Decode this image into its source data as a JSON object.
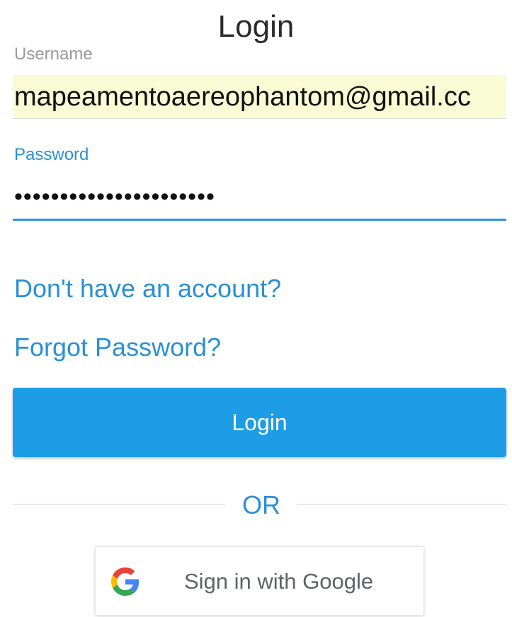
{
  "page": {
    "title": "Login"
  },
  "form": {
    "username_label": "Username",
    "username_value": "mapeamentoaereophantom@gmail.cc",
    "password_label": "Password",
    "password_value": "••••••••••••••••••••••"
  },
  "links": {
    "signup": "Don't have an account?",
    "forgot": "Forgot Password?"
  },
  "buttons": {
    "login": "Login",
    "google": "Sign in with Google"
  },
  "divider": {
    "text": "OR"
  },
  "colors": {
    "accent": "#2b8fd6",
    "login_button": "#1c9de6",
    "autofill_bg": "#f8fbd3"
  },
  "icons": {
    "google": "google-g-icon"
  }
}
